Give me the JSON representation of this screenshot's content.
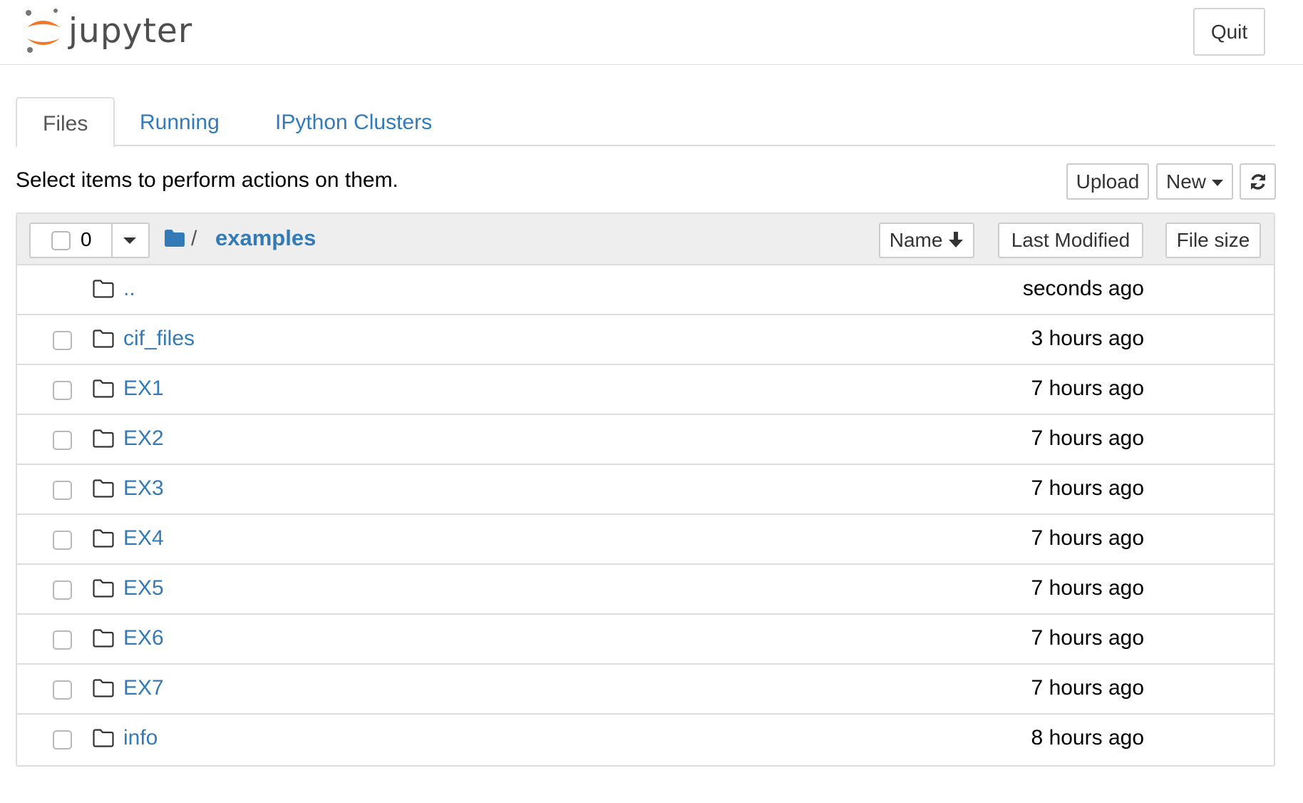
{
  "app": {
    "logo_text": "jupyter",
    "quit_label": "Quit"
  },
  "tabs": [
    {
      "label": "Files",
      "active": true
    },
    {
      "label": "Running",
      "active": false
    },
    {
      "label": "IPython Clusters",
      "active": false
    }
  ],
  "toolbar": {
    "instructions": "Select items to perform actions on them.",
    "upload_label": "Upload",
    "new_label": "New",
    "refresh_icon": "refresh-icon"
  },
  "list_header": {
    "selected_count": "0",
    "breadcrumb_separator": "/",
    "current_folder": "examples",
    "sort_name_label": "Name",
    "sort_modified_label": "Last Modified",
    "sort_size_label": "File size"
  },
  "items": [
    {
      "name": "..",
      "modified": "seconds ago",
      "type": "folder",
      "checkbox": false
    },
    {
      "name": "cif_files",
      "modified": "3 hours ago",
      "type": "folder",
      "checkbox": true
    },
    {
      "name": "EX1",
      "modified": "7 hours ago",
      "type": "folder",
      "checkbox": true
    },
    {
      "name": "EX2",
      "modified": "7 hours ago",
      "type": "folder",
      "checkbox": true
    },
    {
      "name": "EX3",
      "modified": "7 hours ago",
      "type": "folder",
      "checkbox": true
    },
    {
      "name": "EX4",
      "modified": "7 hours ago",
      "type": "folder",
      "checkbox": true
    },
    {
      "name": "EX5",
      "modified": "7 hours ago",
      "type": "folder",
      "checkbox": true
    },
    {
      "name": "EX6",
      "modified": "7 hours ago",
      "type": "folder",
      "checkbox": true
    },
    {
      "name": "EX7",
      "modified": "7 hours ago",
      "type": "folder",
      "checkbox": true
    },
    {
      "name": "info",
      "modified": "8 hours ago",
      "type": "folder",
      "checkbox": true
    }
  ],
  "colors": {
    "link": "#337ab7",
    "logo_orange": "#f37726",
    "header_bg": "#eeeeee"
  }
}
